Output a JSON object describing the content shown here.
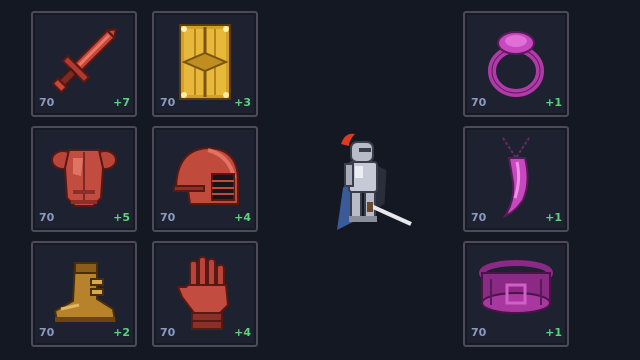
{
  "equipment": {
    "sword": {
      "level": "70",
      "bonus": "+7",
      "icon": "sword-icon"
    },
    "shield": {
      "level": "70",
      "bonus": "+3",
      "icon": "shield-icon"
    },
    "armor": {
      "level": "70",
      "bonus": "+5",
      "icon": "chest-armor-icon"
    },
    "helmet": {
      "level": "70",
      "bonus": "+4",
      "icon": "helmet-icon"
    },
    "boots": {
      "level": "70",
      "bonus": "+2",
      "icon": "boots-icon"
    },
    "gloves": {
      "level": "70",
      "bonus": "+4",
      "icon": "gauntlet-icon"
    },
    "ring": {
      "level": "70",
      "bonus": "+1",
      "icon": "ring-icon"
    },
    "necklace": {
      "level": "70",
      "bonus": "+1",
      "icon": "fang-necklace-icon"
    },
    "belt": {
      "level": "70",
      "bonus": "+1",
      "icon": "belt-icon"
    }
  },
  "colors": {
    "background": "#141823",
    "slot_border": "#4e4a59",
    "level_text": "#8d9bc0",
    "bonus_text": "#5fd27a",
    "red_tier": "#c04a3c",
    "gold_tier": "#d4a02a",
    "purple_tier": "#c040b8"
  }
}
